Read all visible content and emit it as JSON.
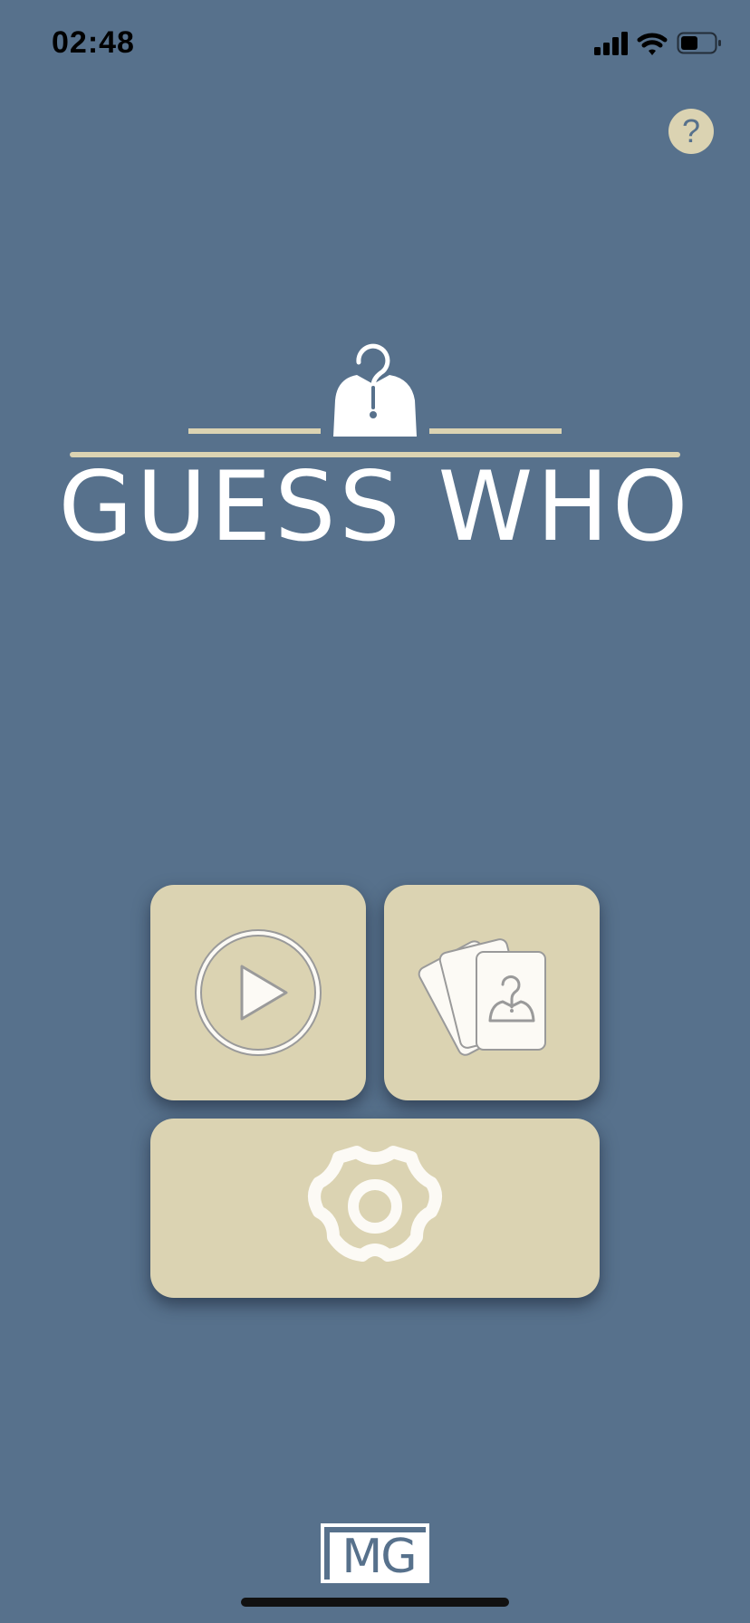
{
  "status_bar": {
    "time": "02:48",
    "icons": [
      "signal-icon",
      "wifi-icon",
      "battery-icon"
    ]
  },
  "help": {
    "label": "?",
    "icon": "question-icon"
  },
  "logo": {
    "title": "GUESS WHO",
    "icon": "person-question-icon"
  },
  "menu": {
    "play_icon": "play-icon",
    "cards_icon": "cards-icon",
    "settings_icon": "gear-icon"
  },
  "brand": {
    "text": "MG"
  },
  "colors": {
    "background": "#57718c",
    "tile": "#dbd3b2",
    "icon_fill": "#fcfaf5",
    "icon_stroke": "#9a9a9a",
    "text": "#ffffff"
  }
}
